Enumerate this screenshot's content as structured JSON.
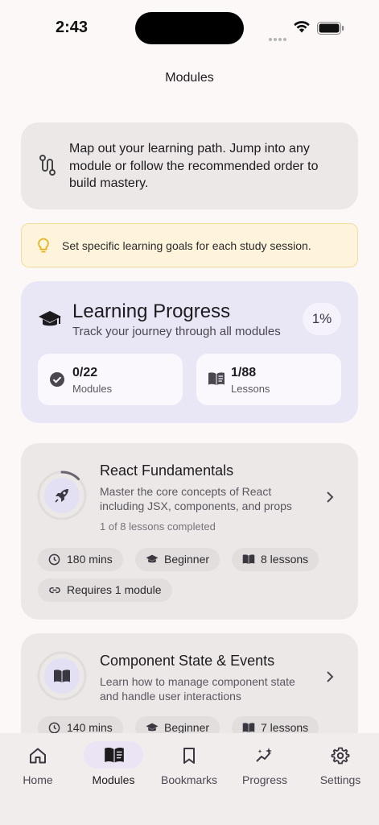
{
  "status": {
    "time": "2:43"
  },
  "header": {
    "title": "Modules"
  },
  "intro": {
    "text": "Map out your learning path. Jump into any module or follow the recommended order to build mastery."
  },
  "tip": {
    "text": "Set specific learning goals for each study session."
  },
  "progress": {
    "title": "Learning Progress",
    "subtitle": "Track your journey through all modules",
    "percent": "1%",
    "modules_value": "0/22",
    "modules_label": "Modules",
    "lessons_value": "1/88",
    "lessons_label": "Lessons"
  },
  "modules": [
    {
      "title": "React Fundamentals",
      "description": "Master the core concepts of React including JSX, components, and props",
      "meta": "1 of 8 lessons completed",
      "icon": "rocket-icon",
      "completion": 0.125,
      "chips": [
        "180 mins",
        "Beginner",
        "8 lessons",
        "Requires 1 module"
      ]
    },
    {
      "title": "Component State & Events",
      "description": "Learn how to manage component state and handle user interactions",
      "icon": "book-icon",
      "completion": 0,
      "chips": [
        "140 mins",
        "Beginner",
        "7 lessons"
      ]
    }
  ],
  "nav": {
    "items": [
      {
        "label": "Home",
        "icon": "home-icon"
      },
      {
        "label": "Modules",
        "icon": "book-open-icon",
        "active": true
      },
      {
        "label": "Bookmarks",
        "icon": "bookmark-icon"
      },
      {
        "label": "Progress",
        "icon": "sparkle-chart-icon"
      },
      {
        "label": "Settings",
        "icon": "gear-icon"
      }
    ]
  },
  "colors": {
    "background": "#fcf8f8",
    "progress_card": "#e9e6f6",
    "tip_card": "#fdf4db",
    "accent": "#6b5fa8"
  }
}
